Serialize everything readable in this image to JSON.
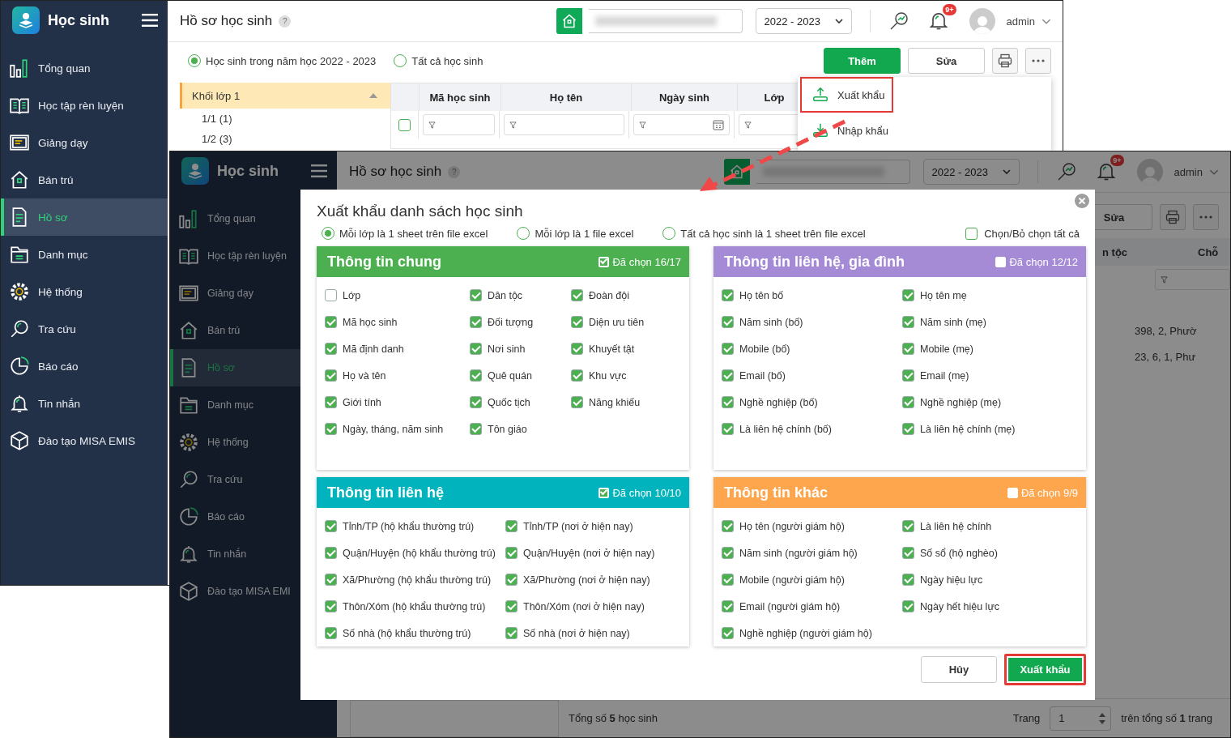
{
  "back_window": {
    "app_name": "Học sinh",
    "sidebar": [
      {
        "label": "Tổng quan",
        "selected": false
      },
      {
        "label": "Học tập rèn luyện",
        "selected": false
      },
      {
        "label": "Giảng dạy",
        "selected": false
      },
      {
        "label": "Bán trú",
        "selected": false
      },
      {
        "label": "Hồ sơ",
        "selected": true
      },
      {
        "label": "Danh mục",
        "selected": false
      },
      {
        "label": "Hệ thống",
        "selected": false
      },
      {
        "label": "Tra cứu",
        "selected": false
      },
      {
        "label": "Báo cáo",
        "selected": false
      },
      {
        "label": "Tin nhắn",
        "selected": false
      },
      {
        "label": "Đào tạo MISA EMIS",
        "selected": false
      }
    ],
    "page_title": "Hồ sơ học sinh",
    "help": "?",
    "school_year": "2022 - 2023",
    "notification_badge": "9+",
    "user": "admin",
    "filters": [
      {
        "label": "Học sinh trong năm học 2022 - 2023",
        "selected": true
      },
      {
        "label": "Tất cả học sinh",
        "selected": false
      }
    ],
    "toolbar": {
      "add": "Thêm",
      "edit": "Sửa"
    },
    "tree": [
      {
        "label": "Khối lớp 1",
        "expanded": true,
        "selected": true,
        "children": [
          {
            "label": "1/1 (1)"
          },
          {
            "label": "1/2 (3)"
          }
        ]
      }
    ],
    "table": {
      "select_all": {
        "checked": false
      },
      "columns": [
        "Mã học sinh",
        "Họ tên",
        "Ngày sinh",
        "Lớp"
      ]
    },
    "more_menu": [
      {
        "label": "Xuất khẩu",
        "highlighted": true
      },
      {
        "label": "Nhập khẩu",
        "highlighted": false
      }
    ]
  },
  "front_window": {
    "app_name": "Học sinh",
    "sidebar": [
      {
        "label": "Tổng quan",
        "selected": false
      },
      {
        "label": "Học tập rèn luyện",
        "selected": false
      },
      {
        "label": "Giảng dạy",
        "selected": false
      },
      {
        "label": "Bán trú",
        "selected": false
      },
      {
        "label": "Hồ sơ",
        "selected": true
      },
      {
        "label": "Danh mục",
        "selected": false
      },
      {
        "label": "Hệ thống",
        "selected": false
      },
      {
        "label": "Tra cứu",
        "selected": false
      },
      {
        "label": "Báo cáo",
        "selected": false
      },
      {
        "label": "Tin nhắn",
        "selected": false
      },
      {
        "label": "Đào tạo MISA EMI",
        "selected": false
      }
    ],
    "page_title": "Hồ sơ học sinh",
    "help": "?",
    "school_year": "2022 - 2023",
    "notification_badge": "9+",
    "user": "admin",
    "toolbar": {
      "edit": "Sửa"
    },
    "table": {
      "columns": [
        "n tộc",
        "Chỗ"
      ],
      "rows": [
        "398, 2, Phườ",
        "23, 6, 1, Phư"
      ]
    },
    "footer": {
      "total": "Tổng số **5** học sinh",
      "page_label": "Trang",
      "page": "1",
      "page_total": "trên tổng số **1** trang"
    }
  },
  "dialog": {
    "title": "Xuất khẩu danh sách học sinh",
    "modes": [
      {
        "label": "Mỗi lớp là 1 sheet trên file excel",
        "selected": true
      },
      {
        "label": "Mỗi lớp là 1 file excel",
        "selected": false
      },
      {
        "label": "Tất cả học sinh là 1 sheet trên file excel",
        "selected": false
      }
    ],
    "select_all": {
      "label": "Chọn/Bỏ chọn tất cả",
      "checked": false
    },
    "groups": [
      {
        "title": "Thông tin chung",
        "color": "#4caf50",
        "header_checked": true,
        "count": "Đã chọn 16/17",
        "columns": [
          [
            {
              "label": "Lớp",
              "checked": false
            },
            {
              "label": "Mã học sinh",
              "checked": true
            },
            {
              "label": "Mã định danh",
              "checked": true
            },
            {
              "label": "Họ và tên",
              "checked": true
            },
            {
              "label": "Giới tính",
              "checked": true
            },
            {
              "label": "Ngày, tháng, năm sinh",
              "checked": true
            }
          ],
          [
            {
              "label": "Dân tộc",
              "checked": true
            },
            {
              "label": "Đối tượng",
              "checked": true
            },
            {
              "label": "Nơi sinh",
              "checked": true
            },
            {
              "label": "Quê quán",
              "checked": true
            },
            {
              "label": "Quốc tịch",
              "checked": true
            },
            {
              "label": "Tôn giáo",
              "checked": true
            }
          ],
          [
            {
              "label": "Đoàn đội",
              "checked": true
            },
            {
              "label": "Diện ưu tiên",
              "checked": true
            },
            {
              "label": "Khuyết tật",
              "checked": true
            },
            {
              "label": "Khu vực",
              "checked": true
            },
            {
              "label": "Năng khiếu",
              "checked": true
            }
          ]
        ]
      },
      {
        "title": "Thông tin liên hệ, gia đình",
        "color": "#a58bd6",
        "header_checked": false,
        "count": "Đã chọn 12/12",
        "columns": [
          [
            {
              "label": "Họ tên bố",
              "checked": true
            },
            {
              "label": "Năm sinh (bố)",
              "checked": true
            },
            {
              "label": "Mobile (bố)",
              "checked": true
            },
            {
              "label": "Email (bố)",
              "checked": true
            },
            {
              "label": "Nghề nghiệp (bố)",
              "checked": true
            },
            {
              "label": "Là liên hệ chính (bố)",
              "checked": true
            }
          ],
          [
            {
              "label": "Họ tên mẹ",
              "checked": true
            },
            {
              "label": "Năm sinh (mẹ)",
              "checked": true
            },
            {
              "label": "Mobile (mẹ)",
              "checked": true
            },
            {
              "label": "Email (mẹ)",
              "checked": true
            },
            {
              "label": "Nghề nghiệp (mẹ)",
              "checked": true
            },
            {
              "label": "Là liên hệ chính (mẹ)",
              "checked": true
            }
          ]
        ]
      },
      {
        "title": "Thông tin liên hệ",
        "color": "#00b3bd",
        "header_checked": true,
        "count": "Đã chọn 10/10",
        "columns": [
          [
            {
              "label": "Tỉnh/TP (hộ khẩu thường trú)",
              "checked": true
            },
            {
              "label": "Quận/Huyện (hộ khẩu thường trú)",
              "checked": true
            },
            {
              "label": "Xã/Phường (hộ khẩu thường trú)",
              "checked": true
            },
            {
              "label": "Thôn/Xóm (hộ khẩu thường trú)",
              "checked": true
            },
            {
              "label": "Số nhà (hộ khẩu thường trú)",
              "checked": true
            }
          ],
          [
            {
              "label": "Tỉnh/TP (nơi ở hiện nay)",
              "checked": true
            },
            {
              "label": "Quận/Huyện (nơi ở hiện nay)",
              "checked": true
            },
            {
              "label": "Xã/Phường (nơi ở hiện nay)",
              "checked": true
            },
            {
              "label": "Thôn/Xóm (nơi ở hiện nay)",
              "checked": true
            },
            {
              "label": "Số nhà (nơi ở hiện nay)",
              "checked": true
            }
          ]
        ]
      },
      {
        "title": "Thông tin khác",
        "color": "#fda64d",
        "header_checked": false,
        "count": "Đã chọn 9/9",
        "columns": [
          [
            {
              "label": "Họ tên (người giám hộ)",
              "checked": true
            },
            {
              "label": "Năm sinh (người giám hộ)",
              "checked": true
            },
            {
              "label": "Mobile (người giám hộ)",
              "checked": true
            },
            {
              "label": "Email (người giám hộ)",
              "checked": true
            },
            {
              "label": "Nghề nghiệp (người giám hộ)",
              "checked": true
            }
          ],
          [
            {
              "label": "Là liên hệ chính",
              "checked": true
            },
            {
              "label": "Số sổ (hộ nghèo)",
              "checked": true
            },
            {
              "label": "Ngày hiệu lực",
              "checked": true
            },
            {
              "label": "Ngày hết hiệu lực",
              "checked": true
            }
          ]
        ]
      }
    ],
    "buttons": {
      "cancel": "Hủy",
      "export": "Xuất khẩu",
      "export_highlighted": true
    }
  }
}
